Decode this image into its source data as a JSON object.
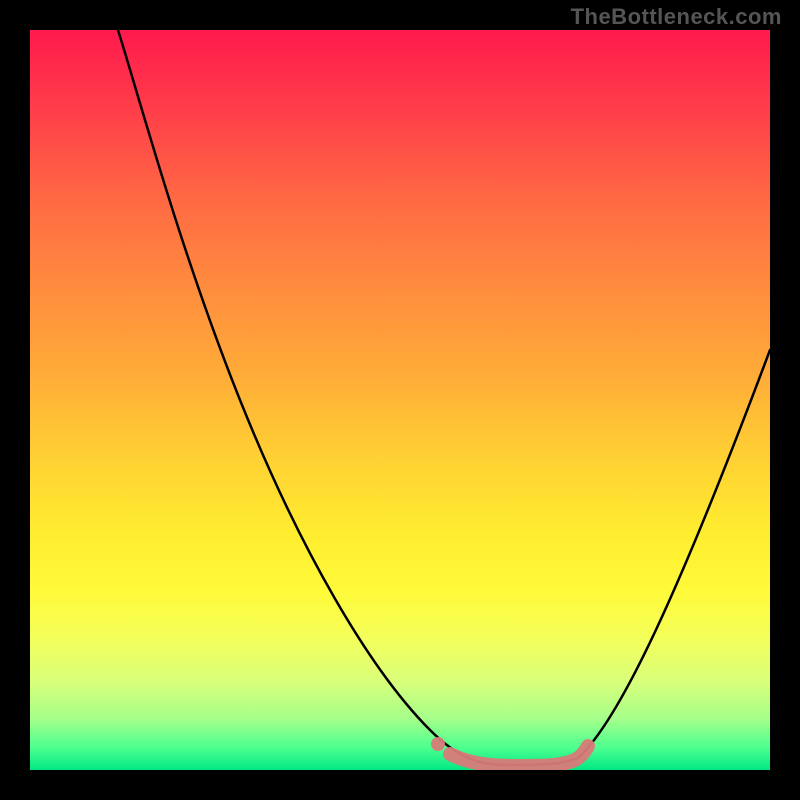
{
  "watermark": "TheBottleneck.com",
  "chart_data": {
    "type": "line",
    "title": "",
    "xlabel": "",
    "ylabel": "",
    "xlim": [
      0,
      100
    ],
    "ylim": [
      0,
      100
    ],
    "series": [
      {
        "name": "bottleneck-curve",
        "x": [
          12,
          16,
          22,
          28,
          34,
          40,
          46,
          52,
          56,
          60,
          64,
          68,
          72,
          76,
          80,
          84,
          88,
          92,
          96,
          100
        ],
        "y": [
          100,
          92,
          80,
          68,
          56,
          44,
          33,
          22,
          14,
          8,
          3,
          1,
          1,
          2,
          5,
          12,
          22,
          34,
          46,
          58
        ]
      }
    ],
    "flat_region": {
      "x_start": 58,
      "x_end": 74,
      "y": 1
    },
    "optimal_range_marker": {
      "x_start": 58,
      "x_end": 74,
      "color": "#e07070"
    },
    "gradient_stops": [
      {
        "pos": 0,
        "color": "#ff1a4d"
      },
      {
        "pos": 50,
        "color": "#ffd133"
      },
      {
        "pos": 80,
        "color": "#fffa3a"
      },
      {
        "pos": 100,
        "color": "#00e984"
      }
    ]
  }
}
